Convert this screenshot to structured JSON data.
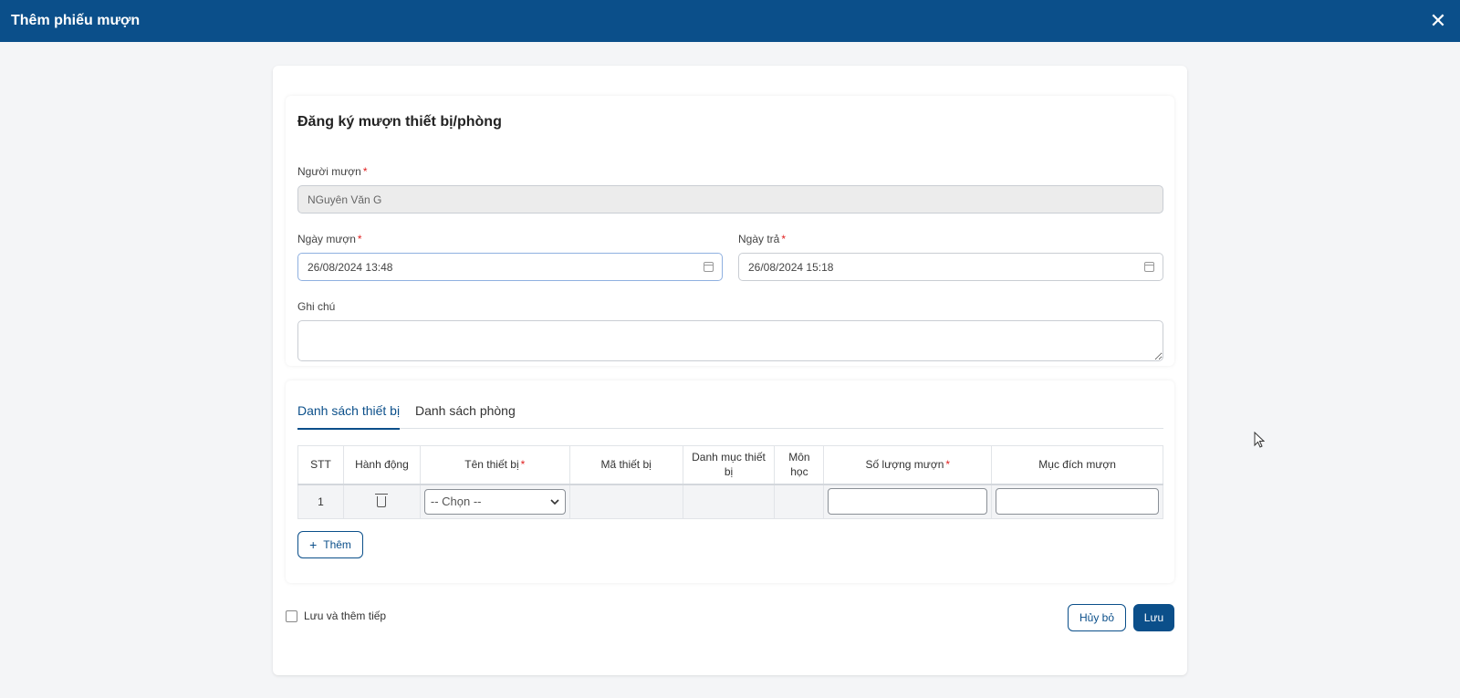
{
  "modal": {
    "title": "Thêm phiếu mượn",
    "close_glyph": "✕"
  },
  "form": {
    "section_title": "Đăng ký mượn thiết bị/phòng",
    "required_mark": "*",
    "borrower": {
      "label": "Người mượn",
      "value": "NGuyên Văn G"
    },
    "borrow_date": {
      "label": "Ngày mượn",
      "value": "26/08/2024 13:48"
    },
    "return_date": {
      "label": "Ngày trả",
      "value": "26/08/2024 15:18"
    },
    "note": {
      "label": "Ghi chú",
      "value": ""
    }
  },
  "tabs": [
    {
      "label": "Danh sách thiết bị",
      "active": true
    },
    {
      "label": "Danh sách phòng",
      "active": false
    }
  ],
  "table": {
    "columns": [
      "STT",
      "Hành động",
      "Tên thiết bị",
      "Mã thiết bị",
      "Danh mục thiết bị",
      "Môn học",
      "Số lượng mượn",
      "Mục đích mượn"
    ],
    "rows": [
      {
        "stt": "1",
        "device_select": "-- Chọn --",
        "code": "",
        "category": "",
        "subject": "",
        "quantity": "",
        "purpose": ""
      }
    ]
  },
  "add_button": {
    "icon": "+",
    "label": "Thêm"
  },
  "save_and_continue": {
    "label": "Lưu và thêm tiếp",
    "checked": false
  },
  "footer": {
    "cancel_label": "Hủy bỏ",
    "save_label": "Lưu"
  },
  "colors": {
    "primary": "#0b4f8a",
    "required": "#e02020"
  }
}
